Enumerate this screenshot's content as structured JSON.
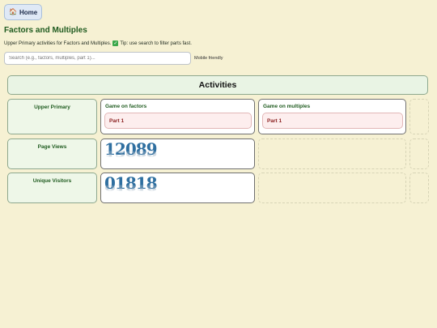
{
  "home": {
    "icon": "home-icon",
    "label": "Home"
  },
  "page": {
    "title": "Factors and Multiples",
    "intro": "Upper Primary activities for Factors and Multiples.",
    "tip": "Tip: use search to filter parts fast."
  },
  "search": {
    "placeholder": "Search (e.g., factors, multiples, part 1)...",
    "value": "",
    "note": "Mobile friendly"
  },
  "table": {
    "header": "Activities",
    "rows": [
      {
        "label": "Upper Primary",
        "games": [
          {
            "title": "Game on factors",
            "part": "Part 1"
          },
          {
            "title": "Game on multiples",
            "part": "Part 1"
          }
        ]
      },
      {
        "label": "Page Views",
        "counter": "12089"
      },
      {
        "label": "Unique Visitors",
        "counter": "01818"
      }
    ]
  },
  "colors": {
    "background": "#f6f1d3",
    "heading": "#1f5b1f",
    "part_button": "#fdeeee",
    "counter": "#2f6fa0"
  }
}
